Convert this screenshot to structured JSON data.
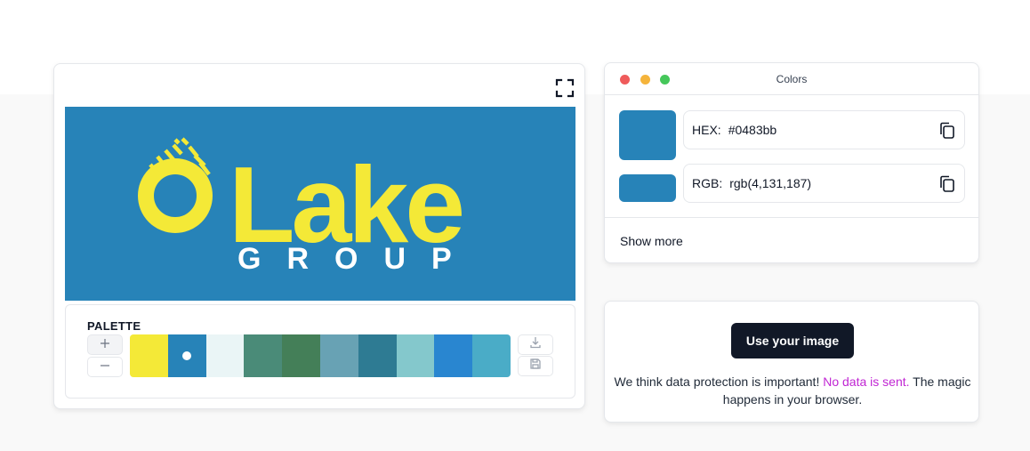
{
  "image_panel": {
    "logo": {
      "background": "#2783b8",
      "foreground": "#f4e937",
      "letter_color": "#ffffff",
      "word": "Lake",
      "subword": "GROUP"
    },
    "expand_icon": "fullscreen-icon"
  },
  "palette": {
    "title": "PALETTE",
    "add_icon": "plus-icon",
    "remove_icon": "minus-icon",
    "download_icon": "download-icon",
    "save_icon": "save-icon",
    "selected_index": 1,
    "swatches": [
      "#f4e937",
      "#2783b8",
      "#eaf5f6",
      "#4a8b78",
      "#447f58",
      "#68a2b4",
      "#2e7b93",
      "#84c8cc",
      "#2986d0",
      "#4aacc7"
    ]
  },
  "colors_window": {
    "title": "Colors",
    "hex_label": "HEX:",
    "hex_value": "#0483bb",
    "rgb_label": "RGB:",
    "rgb_value": "rgb(4,131,187)",
    "preview_color": "#2783b8",
    "copy_icon": "copy-icon",
    "show_more": "Show more"
  },
  "info_card": {
    "button_label": "Use your image",
    "text_before": "We think data protection is important! ",
    "link_text": "No data is sent.",
    "text_after": " The magic happens in your browser."
  }
}
